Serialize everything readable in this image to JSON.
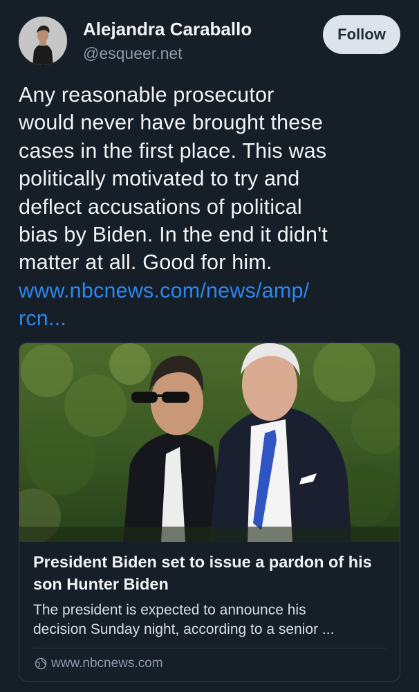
{
  "author": {
    "display_name": "Alejandra Caraballo",
    "handle": "@esqueer.net"
  },
  "follow_button": {
    "label": "Follow"
  },
  "post": {
    "text_lines": [
      "Any reasonable prosecutor",
      "would never have brought these",
      "cases in the first place. This was",
      "politically motivated to try and",
      "deflect accusations of political",
      "bias by Biden. In the end it didn't",
      "matter at all. Good for him."
    ],
    "link_lines": [
      "www.nbcnews.com/news/amp/",
      "rcn..."
    ]
  },
  "link_card": {
    "image_alt_icon": "photo-two-men-icon",
    "title": "President Biden set to issue a pardon of his son Hunter Biden",
    "description_lines": [
      "The president is expected to announce his",
      "decision Sunday night, according to a senior ..."
    ],
    "domain": "www.nbcnews.com",
    "domain_icon": "globe-icon"
  },
  "colors": {
    "background": "#161e27",
    "link": "#2d86f0",
    "follow_bg": "#dce3ea",
    "muted_text": "#8c9aab",
    "card_border": "#2f3b48"
  }
}
